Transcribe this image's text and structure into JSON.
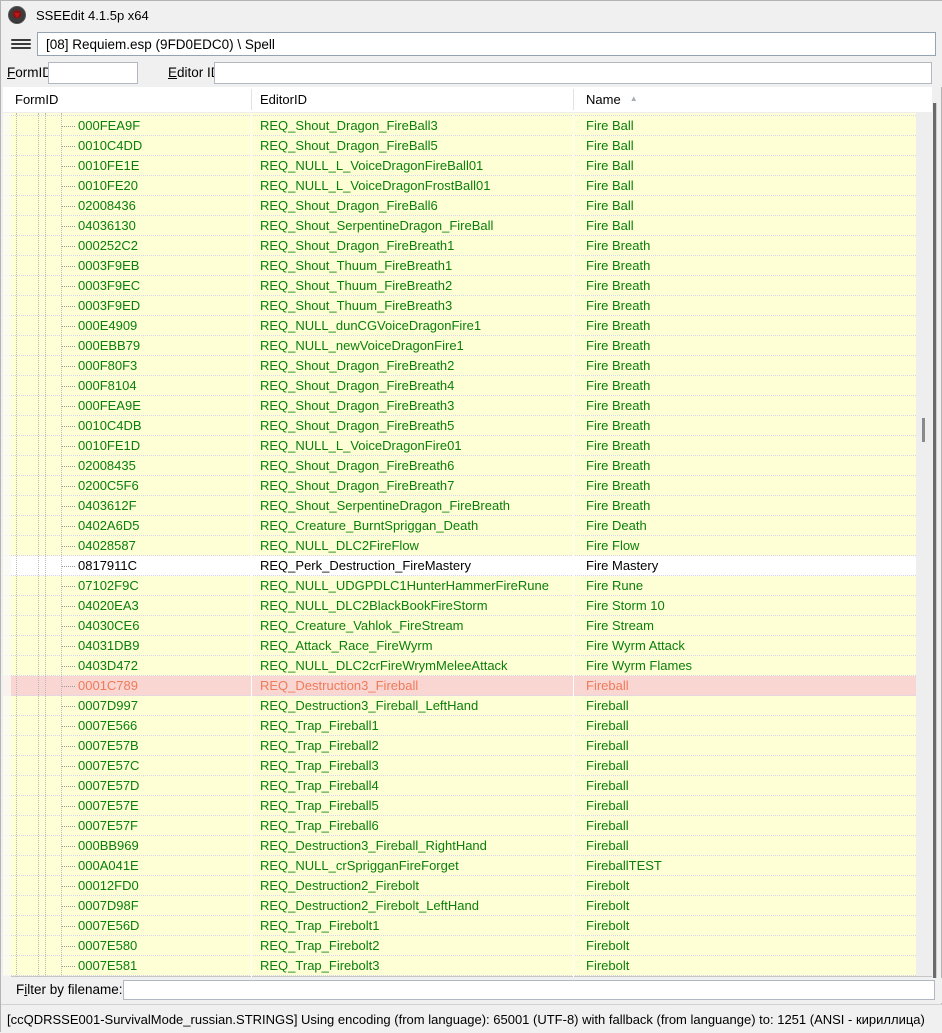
{
  "window": {
    "title": "SSEEdit 4.1.5p x64"
  },
  "toolbar": {
    "menu_icon": "hamburger-menu",
    "breadcrumb": "[08] Requiem.esp (9FD0EDC0) \\ Spell"
  },
  "filters": {
    "formid_label": {
      "key": "F",
      "rest": "ormID"
    },
    "formid_value": "",
    "editorid_label": {
      "key": "E",
      "rest": "ditor ID"
    },
    "editorid_value": ""
  },
  "table": {
    "columns": {
      "formid": "FormID",
      "editorid": "EditorID",
      "name": "Name"
    },
    "sort": {
      "column": "Name",
      "direction": "asc",
      "glyph": "▲"
    },
    "rows": [
      {
        "formid": "000FEA9F",
        "editorid": "REQ_Shout_Dragon_FireBall3",
        "name": "Fire Ball"
      },
      {
        "formid": "0010C4DD",
        "editorid": "REQ_Shout_Dragon_FireBall5",
        "name": "Fire Ball"
      },
      {
        "formid": "0010FE1E",
        "editorid": "REQ_NULL_L_VoiceDragonFireBall01",
        "name": "Fire Ball"
      },
      {
        "formid": "0010FE20",
        "editorid": "REQ_NULL_L_VoiceDragonFrostBall01",
        "name": "Fire Ball"
      },
      {
        "formid": "02008436",
        "editorid": "REQ_Shout_Dragon_FireBall6",
        "name": "Fire Ball"
      },
      {
        "formid": "04036130",
        "editorid": "REQ_Shout_SerpentineDragon_FireBall",
        "name": "Fire Ball"
      },
      {
        "formid": "000252C2",
        "editorid": "REQ_Shout_Dragon_FireBreath1",
        "name": "Fire Breath"
      },
      {
        "formid": "0003F9EB",
        "editorid": "REQ_Shout_Thuum_FireBreath1",
        "name": "Fire Breath"
      },
      {
        "formid": "0003F9EC",
        "editorid": "REQ_Shout_Thuum_FireBreath2",
        "name": "Fire Breath"
      },
      {
        "formid": "0003F9ED",
        "editorid": "REQ_Shout_Thuum_FireBreath3",
        "name": "Fire Breath"
      },
      {
        "formid": "000E4909",
        "editorid": "REQ_NULL_dunCGVoiceDragonFire1",
        "name": "Fire Breath"
      },
      {
        "formid": "000EBB79",
        "editorid": "REQ_NULL_newVoiceDragonFire1",
        "name": "Fire Breath"
      },
      {
        "formid": "000F80F3",
        "editorid": "REQ_Shout_Dragon_FireBreath2",
        "name": "Fire Breath"
      },
      {
        "formid": "000F8104",
        "editorid": "REQ_Shout_Dragon_FireBreath4",
        "name": "Fire Breath"
      },
      {
        "formid": "000FEA9E",
        "editorid": "REQ_Shout_Dragon_FireBreath3",
        "name": "Fire Breath"
      },
      {
        "formid": "0010C4DB",
        "editorid": "REQ_Shout_Dragon_FireBreath5",
        "name": "Fire Breath"
      },
      {
        "formid": "0010FE1D",
        "editorid": "REQ_NULL_L_VoiceDragonFire01",
        "name": "Fire Breath"
      },
      {
        "formid": "02008435",
        "editorid": "REQ_Shout_Dragon_FireBreath6",
        "name": "Fire Breath"
      },
      {
        "formid": "0200C5F6",
        "editorid": "REQ_Shout_Dragon_FireBreath7",
        "name": "Fire Breath"
      },
      {
        "formid": "0403612F",
        "editorid": "REQ_Shout_SerpentineDragon_FireBreath",
        "name": "Fire Breath"
      },
      {
        "formid": "0402A6D5",
        "editorid": "REQ_Creature_BurntSpriggan_Death",
        "name": "Fire Death"
      },
      {
        "formid": "04028587",
        "editorid": "REQ_NULL_DLC2FireFlow",
        "name": "Fire Flow"
      },
      {
        "formid": "0817911C",
        "editorid": "REQ_Perk_Destruction_FireMastery",
        "name": "Fire Mastery",
        "state": "selected"
      },
      {
        "formid": "07102F9C",
        "editorid": "REQ_NULL_UDGPDLC1HunterHammerFireRune",
        "name": "Fire Rune"
      },
      {
        "formid": "04020EA3",
        "editorid": "REQ_NULL_DLC2BlackBookFireStorm",
        "name": "Fire Storm 10"
      },
      {
        "formid": "04030CE6",
        "editorid": "REQ_Creature_Vahlok_FireStream",
        "name": "Fire Stream"
      },
      {
        "formid": "04031DB9",
        "editorid": "REQ_Attack_Race_FireWyrm",
        "name": "Fire Wyrm Attack"
      },
      {
        "formid": "0403D472",
        "editorid": "REQ_NULL_DLC2crFireWrymMeleeAttack",
        "name": "Fire Wyrm Flames"
      },
      {
        "formid": "0001C789",
        "editorid": "REQ_Destruction3_Fireball",
        "name": "Fireball",
        "state": "removed"
      },
      {
        "formid": "0007D997",
        "editorid": "REQ_Destruction3_Fireball_LeftHand",
        "name": "Fireball"
      },
      {
        "formid": "0007E566",
        "editorid": "REQ_Trap_Fireball1",
        "name": "Fireball"
      },
      {
        "formid": "0007E57B",
        "editorid": "REQ_Trap_Fireball2",
        "name": "Fireball"
      },
      {
        "formid": "0007E57C",
        "editorid": "REQ_Trap_Fireball3",
        "name": "Fireball"
      },
      {
        "formid": "0007E57D",
        "editorid": "REQ_Trap_Fireball4",
        "name": "Fireball"
      },
      {
        "formid": "0007E57E",
        "editorid": "REQ_Trap_Fireball5",
        "name": "Fireball"
      },
      {
        "formid": "0007E57F",
        "editorid": "REQ_Trap_Fireball6",
        "name": "Fireball"
      },
      {
        "formid": "000BB969",
        "editorid": "REQ_Destruction3_Fireball_RightHand",
        "name": "Fireball"
      },
      {
        "formid": "000A041E",
        "editorid": "REQ_NULL_crSprigganFireForget",
        "name": "FireballTEST"
      },
      {
        "formid": "00012FD0",
        "editorid": "REQ_Destruction2_Firebolt",
        "name": "Firebolt"
      },
      {
        "formid": "0007D98F",
        "editorid": "REQ_Destruction2_Firebolt_LeftHand",
        "name": "Firebolt"
      },
      {
        "formid": "0007E56D",
        "editorid": "REQ_Trap_Firebolt1",
        "name": "Firebolt"
      },
      {
        "formid": "0007E580",
        "editorid": "REQ_Trap_Firebolt2",
        "name": "Firebolt"
      },
      {
        "formid": "0007E581",
        "editorid": "REQ_Trap_Firebolt3",
        "name": "Firebolt"
      }
    ]
  },
  "bottom_filter": {
    "label": {
      "pre": "F",
      "key": "i",
      "rest": "lter by filename:"
    },
    "value": ""
  },
  "status_bar": {
    "text": "[ccQDRSSE001-SurvivalMode_russian.STRINGS] Using encoding (from language): 65001 (UTF-8) with fallback (from languange) to: 1251  (ANSI - кириллица)"
  },
  "colors": {
    "row_background": "#ffffd5",
    "row_text": "#0a7f0a",
    "selected_row_background": "#ffffff",
    "selected_row_text": "#000000",
    "removed_row_background": "#fad6d3",
    "removed_row_text": "#ef7a58"
  }
}
